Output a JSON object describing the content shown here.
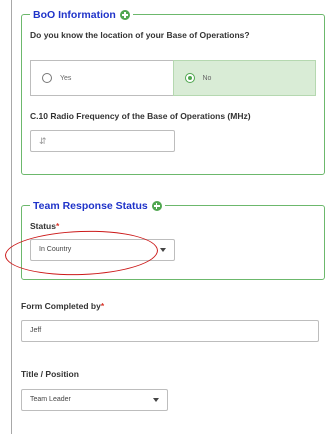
{
  "boo": {
    "legend": "BoO Information",
    "question": "Do you know the location of your Base of Operations?",
    "options": [
      {
        "label": "Yes",
        "selected": false
      },
      {
        "label": "No",
        "selected": true
      }
    ],
    "radio_label": "C.10 Radio Frequency of the Base of Operations (MHz)",
    "radio_value": ""
  },
  "team": {
    "legend": "Team Response Status",
    "status_label": "Status",
    "status_value": "In Country"
  },
  "form": {
    "completed_label": "Form Completed by",
    "completed_value": "Jeff",
    "title_label": "Title / Position",
    "title_value": "Team Leader"
  },
  "required_mark": "*",
  "colors": {
    "legend_blue": "#1f33c9",
    "section_border": "#6cb86c",
    "selected_bg": "#d9ecd6",
    "required": "#d9352a",
    "annotation": "#cc1a1a"
  }
}
